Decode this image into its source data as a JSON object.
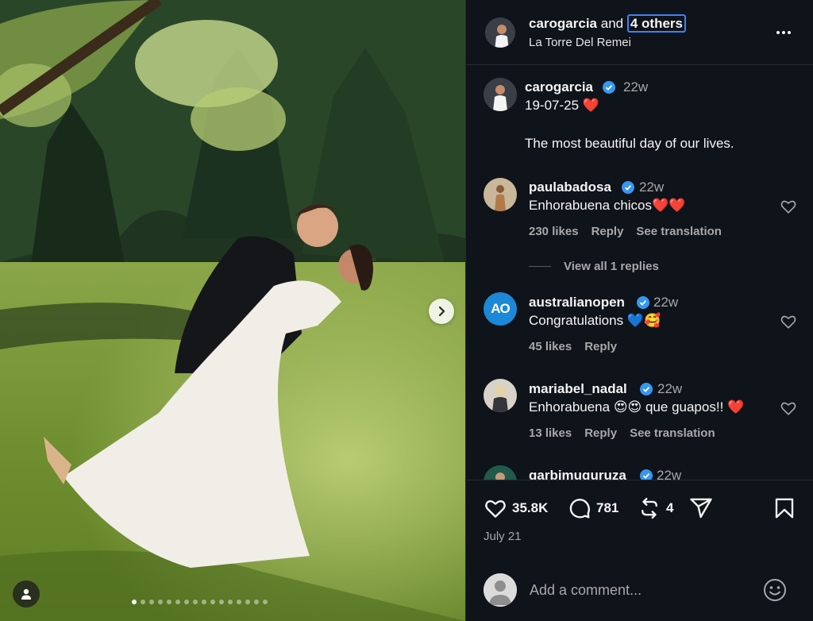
{
  "post": {
    "author": "carogarcia",
    "and_text": "and",
    "others_label": "4 others",
    "location": "La Torre Del Remei",
    "photo_description_icon": "wedding-photo",
    "carousel_dots": 16,
    "active_dot": 0
  },
  "caption": {
    "username": "carogarcia",
    "verified": true,
    "time": "22w",
    "line1": "19-07-25 ❤️",
    "line2": "The most beautiful day of our lives."
  },
  "comments": [
    {
      "username": "paulabadosa",
      "verified": true,
      "time": "22w",
      "text": "Enhorabuena chicos❤️❤️",
      "likes": "230 likes",
      "reply_label": "Reply",
      "translation_label": "See translation"
    },
    {
      "username": "australianopen",
      "verified": true,
      "time": "22w",
      "text": "Congratulations 💙🥰",
      "likes": "45 likes",
      "reply_label": "Reply",
      "translation_label": ""
    },
    {
      "username": "mariabel_nadal",
      "verified": true,
      "time": "22w",
      "text": "Enhorabuena 😍😍 que guapos!! ❤️",
      "likes": "13 likes",
      "reply_label": "Reply",
      "translation_label": "See translation"
    },
    {
      "username": "garbimuguruza",
      "verified": true,
      "time": "22w"
    }
  ],
  "view_replies": "View all 1 replies",
  "ao_logo_text": "AO",
  "actions": {
    "likes": "35.8K",
    "comments": "781",
    "reposts": "4",
    "date": "July 21"
  },
  "comment_box": {
    "placeholder": "Add a comment..."
  },
  "colors": {
    "panel_bg": "#0f131a",
    "verified_blue": "#3797f0",
    "heart_red": "#e0245e",
    "ao_blue": "#1c88d6"
  }
}
